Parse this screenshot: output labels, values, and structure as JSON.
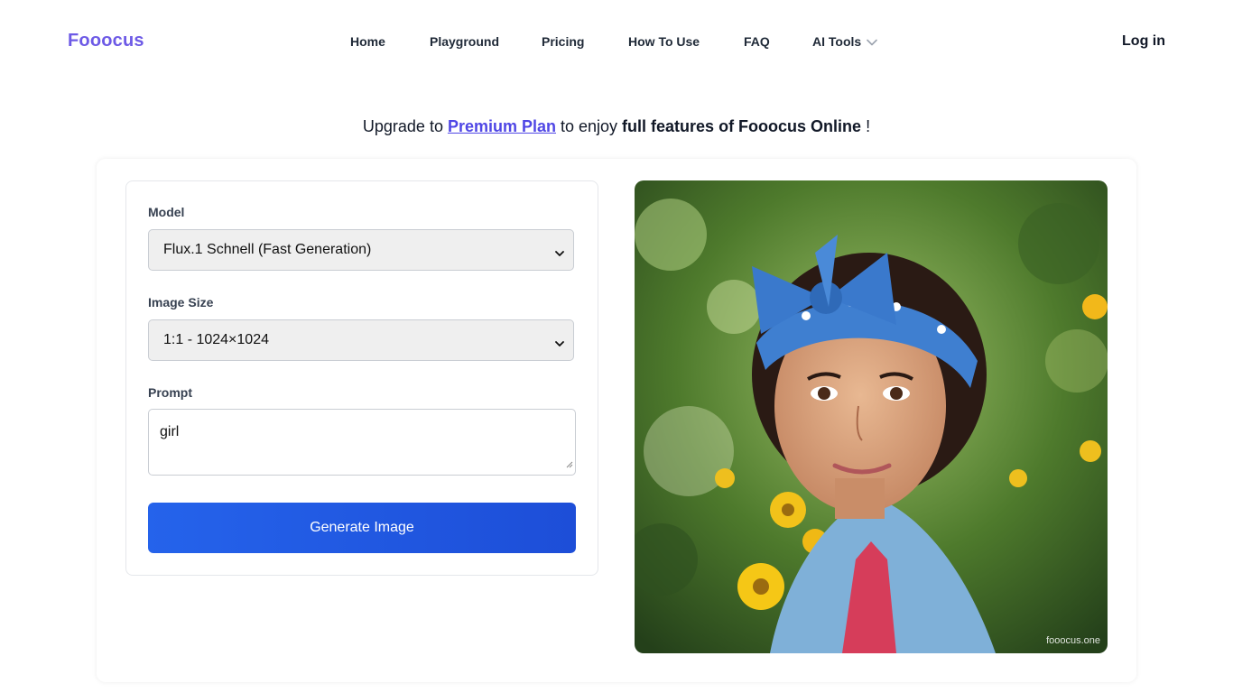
{
  "header": {
    "logo": "Fooocus",
    "nav": [
      {
        "label": "Home"
      },
      {
        "label": "Playground"
      },
      {
        "label": "Pricing"
      },
      {
        "label": "How To Use"
      },
      {
        "label": "FAQ"
      },
      {
        "label": "AI Tools"
      }
    ],
    "login": "Log in"
  },
  "promo": {
    "prefix": "Upgrade to ",
    "link": "Premium Plan",
    "middle": " to enjoy ",
    "bold": "full features of Fooocus Online",
    "suffix": " !"
  },
  "form": {
    "model_label": "Model",
    "model_value": "Flux.1 Schnell (Fast Generation)",
    "size_label": "Image Size",
    "size_value": "1:1 - 1024×1024",
    "prompt_label": "Prompt",
    "prompt_value": "girl",
    "generate_label": "Generate Image"
  },
  "image": {
    "watermark": "fooocus.one",
    "colors": {
      "accent": "#6d5ae6",
      "button": "#2563eb",
      "link": "#4f46e5"
    }
  }
}
